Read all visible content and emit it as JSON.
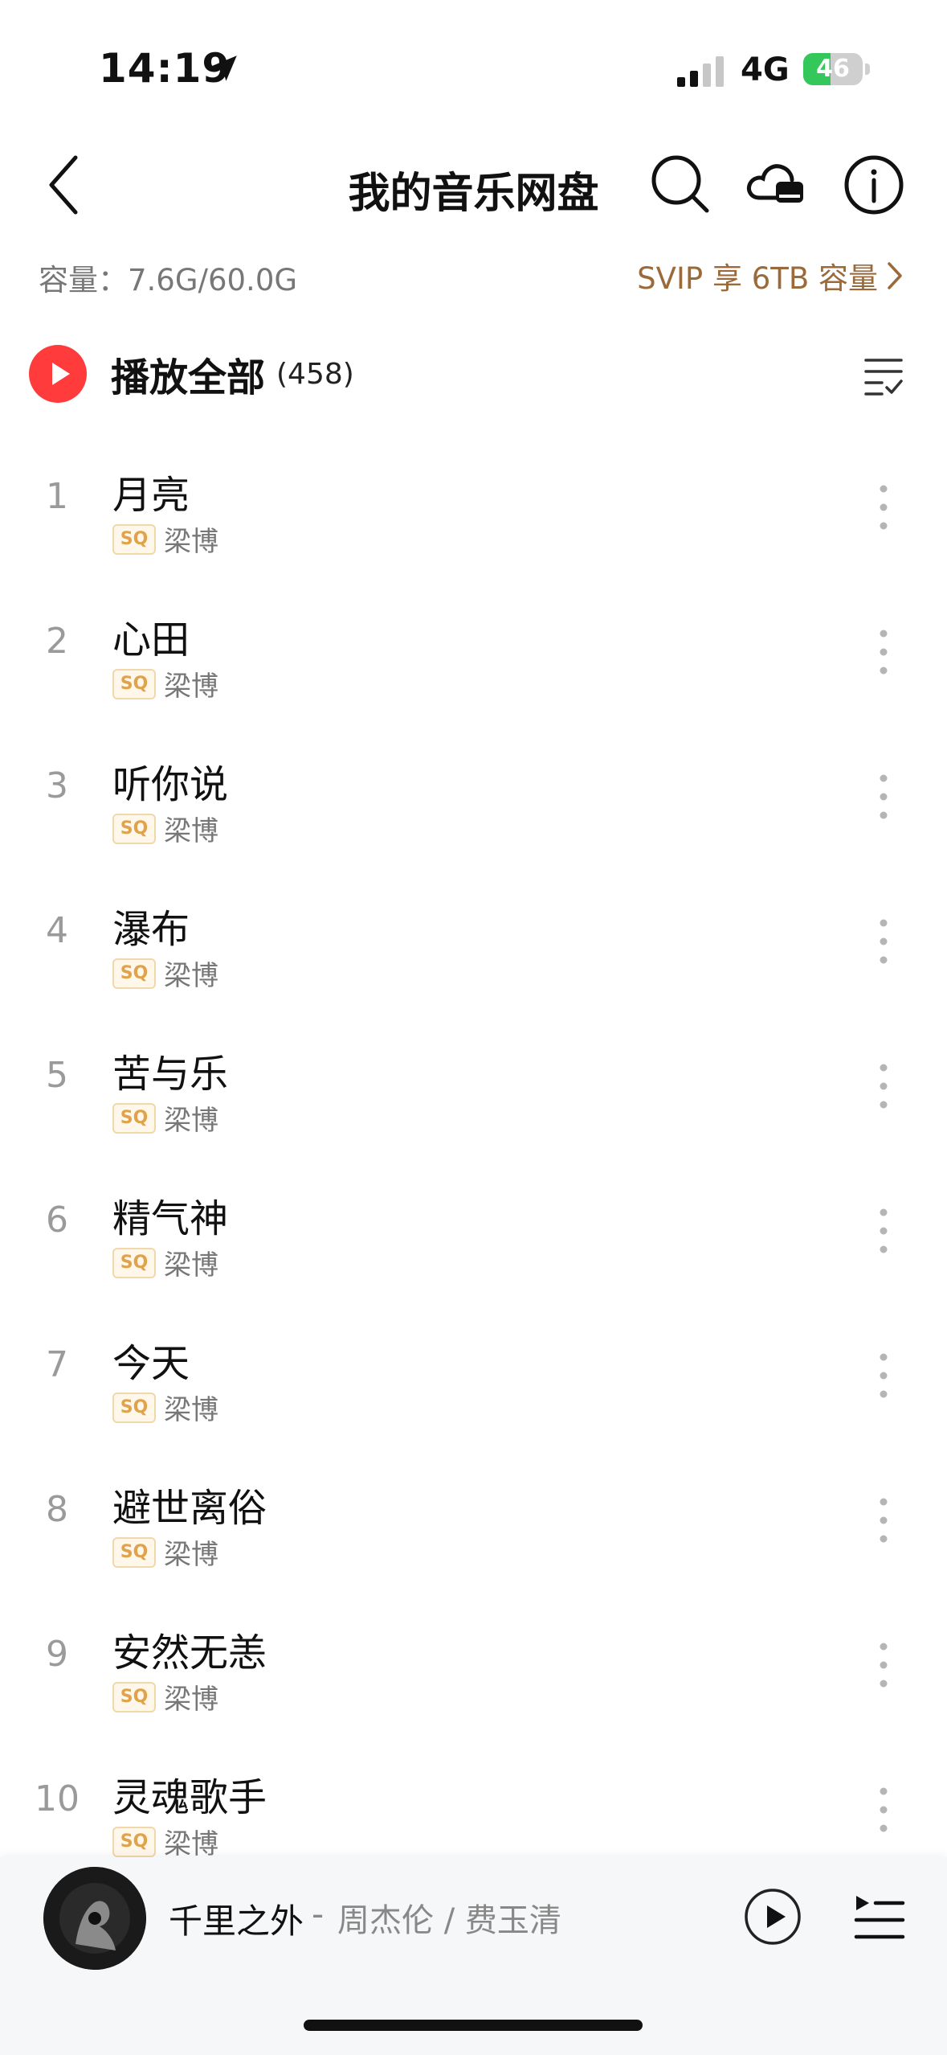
{
  "status_bar": {
    "time": "14:19",
    "network": "4G",
    "battery": "46",
    "battery_level": 0.46,
    "battery_color": "#34c759"
  },
  "nav": {
    "title": "我的音乐网盘",
    "back_icon": "chevron-left-icon",
    "search_icon": "search-icon",
    "cloud_icon": "cloud-drive-icon",
    "info_icon": "info-icon"
  },
  "capacity": {
    "label": "容量：7.6G/60.0G",
    "svip_promo": "SVIP 享 6TB 容量"
  },
  "play_all": {
    "label": "播放全部",
    "count": "(458)",
    "accent_color": "#ff3b3b"
  },
  "songs": [
    {
      "index": "1",
      "title": "月亮",
      "badge": "SQ",
      "artist": "梁博"
    },
    {
      "index": "2",
      "title": "心田",
      "badge": "SQ",
      "artist": "梁博"
    },
    {
      "index": "3",
      "title": "听你说",
      "badge": "SQ",
      "artist": "梁博"
    },
    {
      "index": "4",
      "title": "瀑布",
      "badge": "SQ",
      "artist": "梁博"
    },
    {
      "index": "5",
      "title": "苦与乐",
      "badge": "SQ",
      "artist": "梁博"
    },
    {
      "index": "6",
      "title": "精气神",
      "badge": "SQ",
      "artist": "梁博"
    },
    {
      "index": "7",
      "title": "今天",
      "badge": "SQ",
      "artist": "梁博"
    },
    {
      "index": "8",
      "title": "避世离俗",
      "badge": "SQ",
      "artist": "梁博"
    },
    {
      "index": "9",
      "title": "安然无恙",
      "badge": "SQ",
      "artist": "梁博"
    },
    {
      "index": "10",
      "title": "灵魂歌手",
      "badge": "SQ",
      "artist": "梁博"
    }
  ],
  "now_playing": {
    "title": "千里之外",
    "separator": "-",
    "artist": "周杰伦 / 费玉清"
  },
  "colors": {
    "sq_badge": "#e0a24a",
    "svip_text": "#9a6a3a"
  }
}
